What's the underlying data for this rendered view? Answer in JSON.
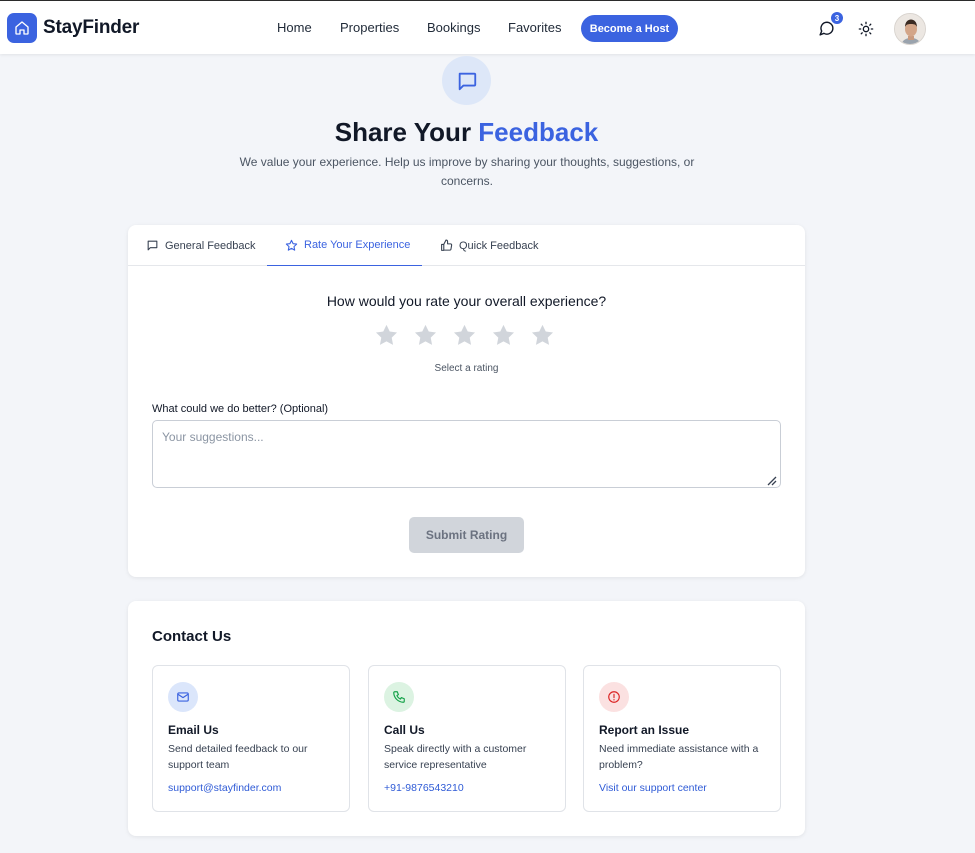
{
  "app": {
    "brand": "StayFinder",
    "nav": [
      "Home",
      "Properties",
      "Bookings",
      "Favorites"
    ],
    "host_button": "Become a Host",
    "notification_count": "3",
    "accent_color": "#3b63e0"
  },
  "hero": {
    "title_main": "Share Your",
    "title_accent": "Feedback",
    "subtitle": "We value your experience. Help us improve by sharing your thoughts, suggestions, or concerns."
  },
  "feedback": {
    "tabs": [
      {
        "label": "General Feedback",
        "icon": "message-icon"
      },
      {
        "label": "Rate Your Experience",
        "icon": "star-icon",
        "active": true
      },
      {
        "label": "Quick Feedback",
        "icon": "thumbs-up-icon"
      }
    ],
    "question": "How would you rate your overall experience?",
    "rating": 0,
    "rating_max": 5,
    "rating_hint": "Select a rating",
    "field_label": "What could we do better? (Optional)",
    "field_placeholder": "Your suggestions...",
    "field_value": "",
    "submit_label": "Submit Rating"
  },
  "contact": {
    "title": "Contact Us",
    "items": [
      {
        "heading": "Email Us",
        "description": "Send detailed feedback to our support team",
        "link": "support@stayfinder.com",
        "icon": "mail-icon",
        "color": "#3b63e0"
      },
      {
        "heading": "Call Us",
        "description": "Speak directly with a customer service representative",
        "link": "+91-9876543210",
        "icon": "phone-icon",
        "color": "#16a34a"
      },
      {
        "heading": "Report an Issue",
        "description": "Need immediate assistance with a problem?",
        "link": "Visit our support center",
        "icon": "alert-icon",
        "color": "#dc2626"
      }
    ]
  }
}
